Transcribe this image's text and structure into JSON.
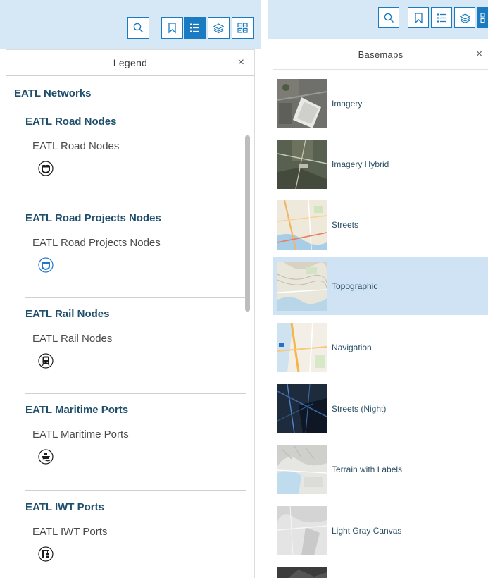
{
  "legend_panel": {
    "title": "Legend",
    "close_glyph": "×",
    "toolbar": [
      "search-icon",
      "bookmark-icon",
      "legend-icon",
      "layers-icon",
      "basemap-gallery-icon"
    ],
    "active_tool": "legend-icon",
    "network_title": "EATL Networks",
    "sections": [
      {
        "title": "EATL Road Nodes",
        "layer": "EATL Road Nodes",
        "symbol": "highway-shield-icon",
        "symbol_color": "#1c1c1c"
      },
      {
        "title": "EATL Road Projects Nodes",
        "layer": "EATL Road Projects Nodes",
        "symbol": "highway-shield-icon",
        "symbol_color": "#2376c9"
      },
      {
        "title": "EATL Rail Nodes",
        "layer": "EATL Rail Nodes",
        "symbol": "train-icon",
        "symbol_color": "#1c1c1c"
      },
      {
        "title": "EATL Maritime Ports",
        "layer": "EATL Maritime Ports",
        "symbol": "ship-icon",
        "symbol_color": "#1c1c1c"
      },
      {
        "title": "EATL IWT Ports",
        "layer": "EATL IWT Ports",
        "symbol": "port-crane-icon",
        "symbol_color": "#1c1c1c"
      }
    ]
  },
  "basemaps_panel": {
    "title": "Basemaps",
    "close_glyph": "×",
    "items": [
      {
        "label": "Imagery",
        "selected": false
      },
      {
        "label": "Imagery Hybrid",
        "selected": false
      },
      {
        "label": "Streets",
        "selected": false
      },
      {
        "label": "Topographic",
        "selected": true
      },
      {
        "label": "Navigation",
        "selected": false
      },
      {
        "label": "Streets (Night)",
        "selected": false
      },
      {
        "label": "Terrain with Labels",
        "selected": false
      },
      {
        "label": "Light Gray Canvas",
        "selected": false
      },
      {
        "label": "",
        "selected": false
      }
    ]
  },
  "colors": {
    "accent": "#1a7bc2",
    "heading": "#1f4f6c",
    "selected_row": "#cfe3f4",
    "map_strip": "#d6e8f5"
  }
}
